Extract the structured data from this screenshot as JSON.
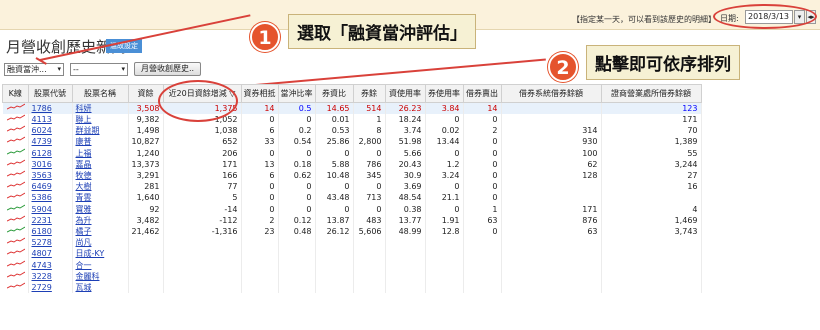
{
  "topbar": {
    "hint": "【指定某一天，可以看到該歷史的明細】",
    "date_label": "日期:",
    "date_value": "2018/3/13"
  },
  "page": {
    "title": "月營收創歷史新高",
    "badge": "溫故設定"
  },
  "toolbar": {
    "select1": "融資當沖...",
    "select2": "--",
    "history_button": "月營收創歷史.."
  },
  "callouts": [
    {
      "num": "1",
      "text": "選取「融資當沖評估」"
    },
    {
      "num": "2",
      "text": "點擊即可依序排列"
    }
  ],
  "table": {
    "headers": [
      "K線",
      "股票代號",
      "股票名稱",
      "資餘",
      "近20日資餘增減 ▽",
      "資券相抵",
      "當沖比率",
      "券資比",
      "券餘",
      "資使用率",
      "券使用率",
      "借券賣出",
      "借券系統借券餘額",
      "證商營業處所借券餘額"
    ],
    "rows": [
      {
        "spark": "r",
        "code": "1786",
        "name": "科妍",
        "vals": [
          "3,508",
          "1,375",
          "14",
          "0.5",
          "14.65",
          "514",
          "26.23",
          "3.84",
          "14",
          "",
          "123"
        ],
        "hl": true
      },
      {
        "spark": "r",
        "code": "4113",
        "name": "聯上",
        "vals": [
          "9,382",
          "1,052",
          "0",
          "0",
          "0.01",
          "1",
          "18.24",
          "0",
          "0",
          "",
          "171"
        ],
        "hl": false
      },
      {
        "spark": "r",
        "code": "6024",
        "name": "群益期",
        "vals": [
          "1,498",
          "1,038",
          "6",
          "0.2",
          "0.53",
          "8",
          "3.74",
          "0.02",
          "2",
          "314",
          "70"
        ],
        "hl": false
      },
      {
        "spark": "r",
        "code": "4739",
        "name": "康普",
        "vals": [
          "10,827",
          "652",
          "33",
          "0.54",
          "25.86",
          "2,800",
          "51.98",
          "13.44",
          "0",
          "930",
          "1,389"
        ],
        "hl": false
      },
      {
        "spark": "g",
        "code": "6128",
        "name": "上福",
        "vals": [
          "1,240",
          "206",
          "0",
          "0",
          "0",
          "0",
          "5.66",
          "0",
          "0",
          "100",
          "55"
        ],
        "hl": false
      },
      {
        "spark": "r",
        "code": "3016",
        "name": "嘉晶",
        "vals": [
          "13,373",
          "171",
          "13",
          "0.18",
          "5.88",
          "786",
          "20.43",
          "1.2",
          "0",
          "62",
          "3,244"
        ],
        "hl": false
      },
      {
        "spark": "r",
        "code": "3563",
        "name": "牧德",
        "vals": [
          "3,291",
          "166",
          "6",
          "0.62",
          "10.48",
          "345",
          "30.9",
          "3.24",
          "0",
          "128",
          "27"
        ],
        "hl": false
      },
      {
        "spark": "r",
        "code": "6469",
        "name": "大樹",
        "vals": [
          "281",
          "77",
          "0",
          "0",
          "0",
          "0",
          "3.69",
          "0",
          "0",
          "",
          "16"
        ],
        "hl": false
      },
      {
        "spark": "r",
        "code": "5386",
        "name": "青雲",
        "vals": [
          "1,640",
          "5",
          "0",
          "0",
          "43.48",
          "713",
          "48.54",
          "21.1",
          "0",
          "",
          ""
        ],
        "hl": false
      },
      {
        "spark": "g",
        "code": "5904",
        "name": "寶雅",
        "vals": [
          "92",
          "-14",
          "0",
          "0",
          "0",
          "0",
          "0.38",
          "0",
          "1",
          "171",
          "4"
        ],
        "hl": false
      },
      {
        "spark": "r",
        "code": "2231",
        "name": "為升",
        "vals": [
          "3,482",
          "-112",
          "2",
          "0.12",
          "13.87",
          "483",
          "13.77",
          "1.91",
          "63",
          "876",
          "1,469"
        ],
        "hl": false
      },
      {
        "spark": "g",
        "code": "6180",
        "name": "橘子",
        "vals": [
          "21,462",
          "-1,316",
          "23",
          "0.48",
          "26.12",
          "5,606",
          "48.99",
          "12.8",
          "0",
          "63",
          "3,743"
        ],
        "hl": false
      },
      {
        "spark": "r",
        "code": "5278",
        "name": "尚凡",
        "vals": [
          "",
          "",
          "",
          "",
          "",
          "",
          "",
          "",
          "",
          "",
          ""
        ],
        "hl": false
      },
      {
        "spark": "r",
        "code": "4807",
        "name": "日成-KY",
        "vals": [
          "",
          "",
          "",
          "",
          "",
          "",
          "",
          "",
          "",
          "",
          ""
        ],
        "hl": false
      },
      {
        "spark": "r",
        "code": "4743",
        "name": "合一",
        "vals": [
          "",
          "",
          "",
          "",
          "",
          "",
          "",
          "",
          "",
          "",
          ""
        ],
        "hl": false
      },
      {
        "spark": "r",
        "code": "3228",
        "name": "金麗科",
        "vals": [
          "",
          "",
          "",
          "",
          "",
          "",
          "",
          "",
          "",
          "",
          ""
        ],
        "hl": false
      },
      {
        "spark": "r",
        "code": "2729",
        "name": "瓦城",
        "vals": [
          "",
          "",
          "",
          "",
          "",
          "",
          "",
          "",
          "",
          "",
          ""
        ],
        "hl": false
      }
    ]
  },
  "colors": {
    "accent": "#e5542d",
    "highlight_row": "#e8f1fb",
    "link": "#1d3fb5",
    "topbar": "#fbf2dc"
  }
}
